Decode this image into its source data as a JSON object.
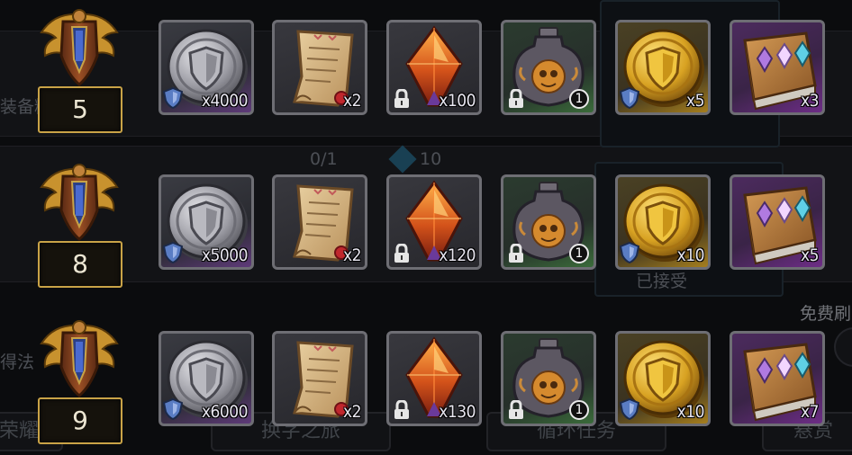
{
  "background": {
    "texts": {
      "left_1": "装备精",
      "left_2": "得法",
      "progress": "0/1",
      "gem_count": "10",
      "accepted": "已接受",
      "free_refresh": "免费刷",
      "tab_1": "荣耀之",
      "tab_2": "换字之旅",
      "tab_3": "循环任务",
      "tab_4": "悬赏"
    }
  },
  "rows": [
    {
      "rank": "5",
      "items": [
        {
          "icon": "silver-shield-coin-icon",
          "badge": "shield",
          "qty": "x4000",
          "frame": "rare"
        },
        {
          "icon": "scroll-icon",
          "badge": "none",
          "qty": "x2",
          "frame": "plain"
        },
        {
          "icon": "fire-crystal-icon",
          "badge": "lock",
          "qty": "x100",
          "frame": "plain"
        },
        {
          "icon": "skull-urn-icon",
          "badge": "lock",
          "qty": "1",
          "frame": "green"
        },
        {
          "icon": "gold-shield-coin-icon",
          "badge": "shield",
          "qty": "x5",
          "frame": "gold"
        },
        {
          "icon": "gem-book-icon",
          "badge": "none",
          "qty": "x3",
          "frame": "epic"
        }
      ]
    },
    {
      "rank": "8",
      "items": [
        {
          "icon": "silver-shield-coin-icon",
          "badge": "shield",
          "qty": "x5000",
          "frame": "rare"
        },
        {
          "icon": "scroll-icon",
          "badge": "none",
          "qty": "x2",
          "frame": "plain"
        },
        {
          "icon": "fire-crystal-icon",
          "badge": "lock",
          "qty": "x120",
          "frame": "plain"
        },
        {
          "icon": "skull-urn-icon",
          "badge": "lock",
          "qty": "1",
          "frame": "green"
        },
        {
          "icon": "gold-shield-coin-icon",
          "badge": "shield",
          "qty": "x10",
          "frame": "gold"
        },
        {
          "icon": "gem-book-icon",
          "badge": "none",
          "qty": "x5",
          "frame": "epic"
        }
      ]
    },
    {
      "rank": "9",
      "items": [
        {
          "icon": "silver-shield-coin-icon",
          "badge": "shield",
          "qty": "x6000",
          "frame": "rare"
        },
        {
          "icon": "scroll-icon",
          "badge": "none",
          "qty": "x2",
          "frame": "plain"
        },
        {
          "icon": "fire-crystal-icon",
          "badge": "lock",
          "qty": "x130",
          "frame": "plain"
        },
        {
          "icon": "skull-urn-icon",
          "badge": "lock",
          "qty": "1",
          "frame": "green"
        },
        {
          "icon": "gold-shield-coin-icon",
          "badge": "shield",
          "qty": "x10",
          "frame": "gold"
        },
        {
          "icon": "gem-book-icon",
          "badge": "none",
          "qty": "x7",
          "frame": "epic"
        }
      ]
    }
  ],
  "colors": {
    "rank_border": "#c9a347",
    "epic_frame": "#6d2d86",
    "gold_frame": "#a57e1e"
  }
}
